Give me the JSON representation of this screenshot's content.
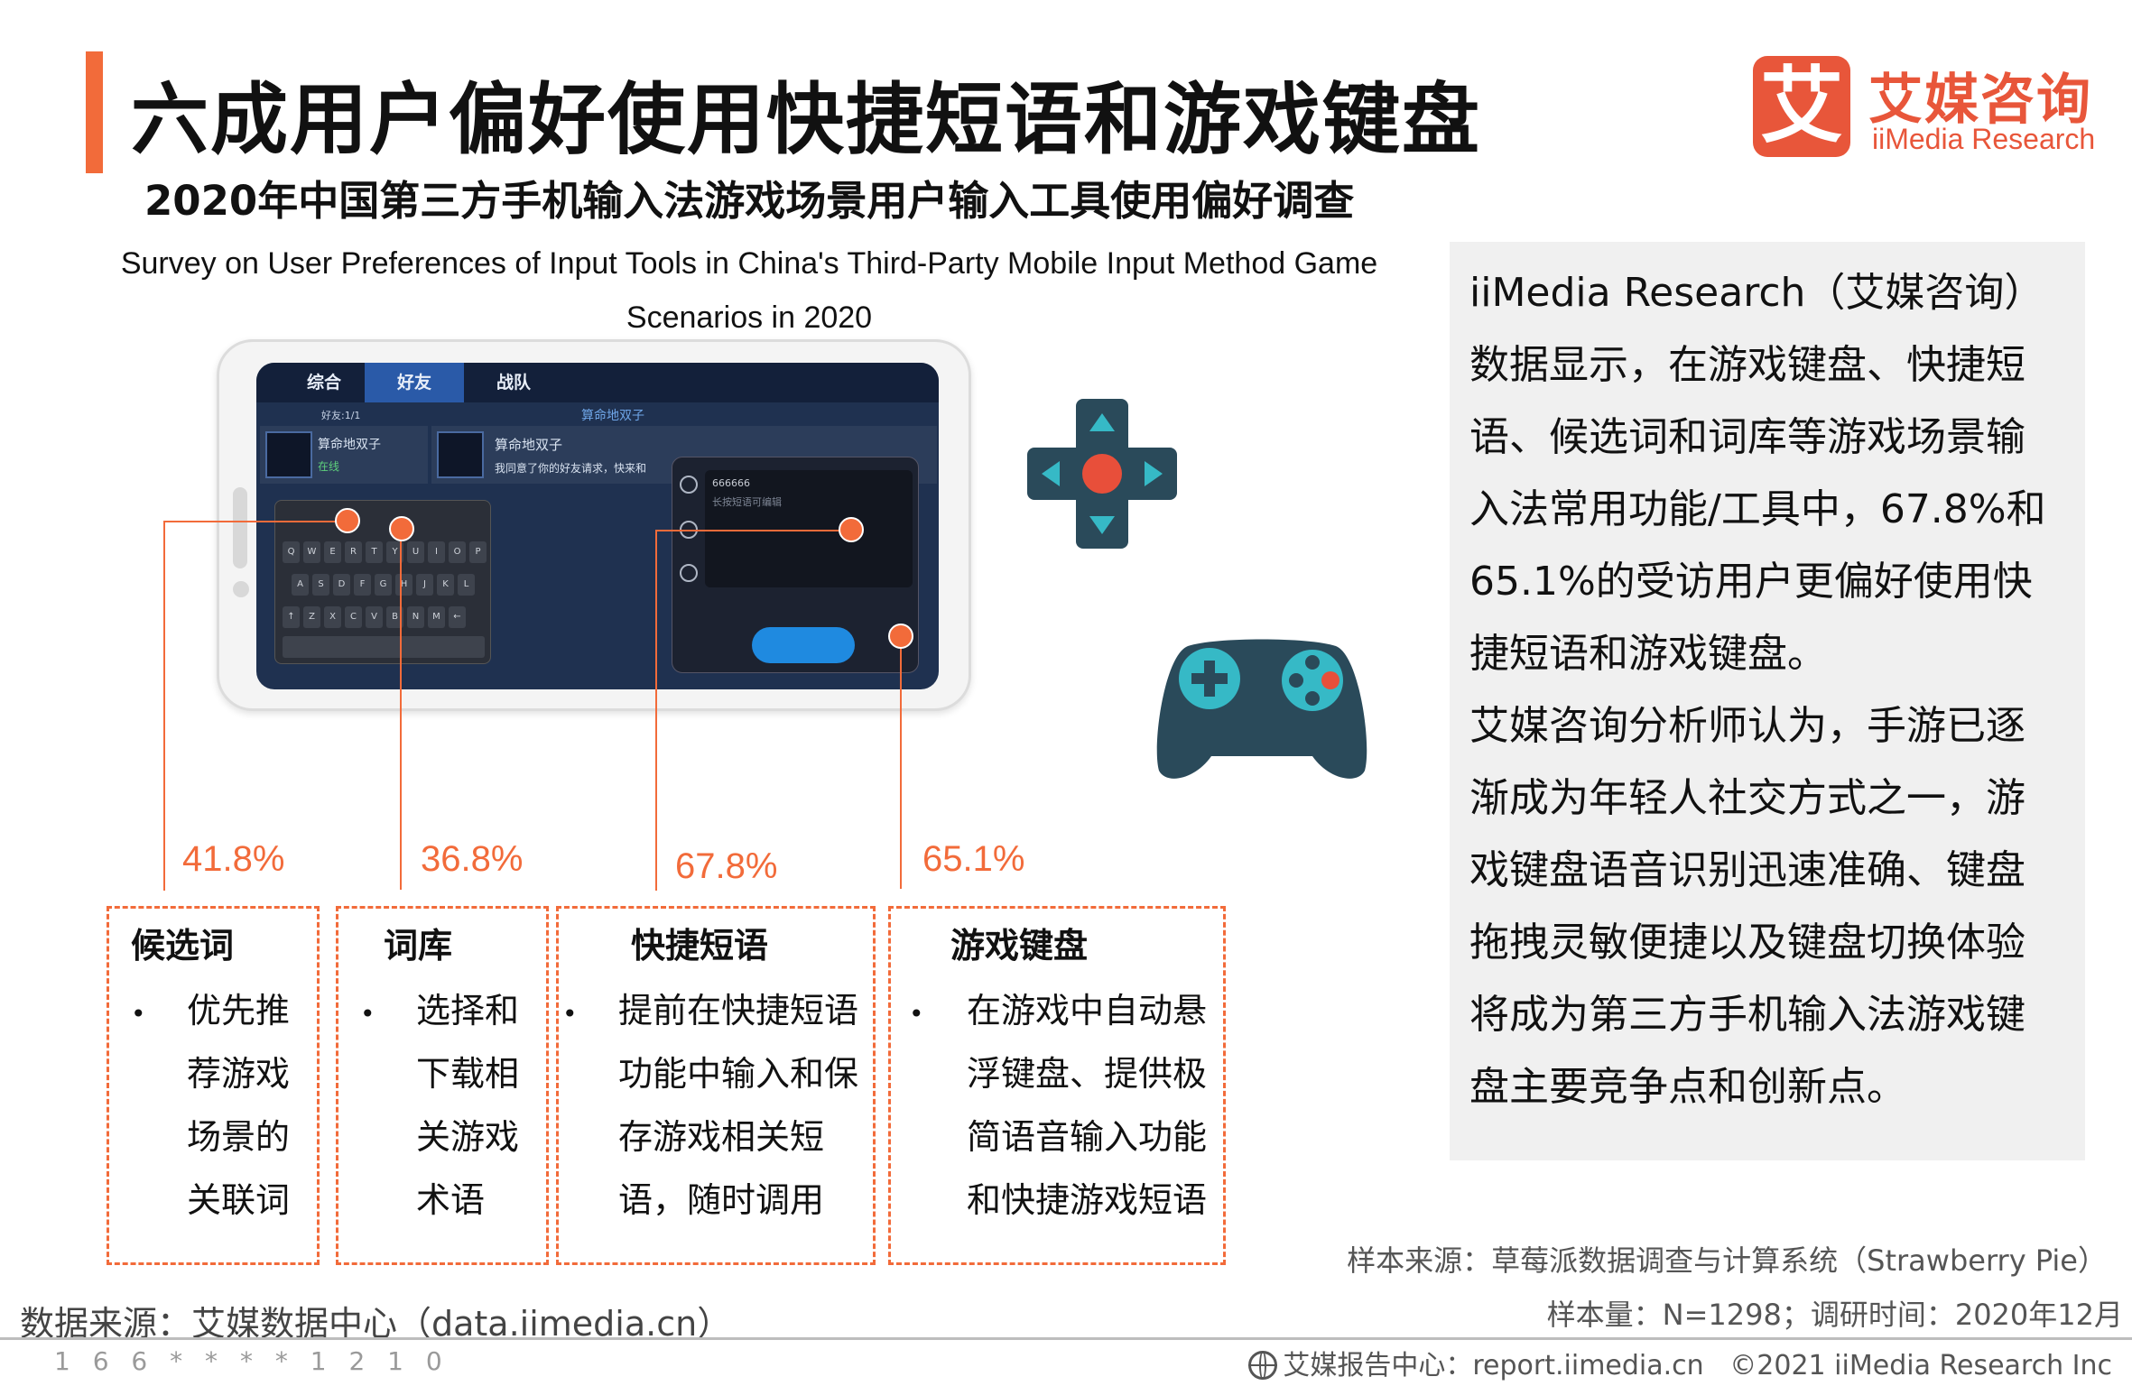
{
  "header": {
    "title": "六成用户偏好使用快捷短语和游戏键盘",
    "subtitle_cn": "2020年中国第三方手机输入法游戏场景用户输入工具使用偏好调查",
    "subtitle_en": "Survey on User Preferences of Input Tools in China's Third-Party Mobile Input Method Game Scenarios in 2020"
  },
  "logo": {
    "mark": "艾",
    "name_cn": "艾媒咨询",
    "name_en": "iiMedia Research",
    "color": "#e8563a"
  },
  "screenshot": {
    "tabs": [
      "综合",
      "好友",
      "战队"
    ],
    "active_tab": 1,
    "friend_name_1": "算命地双子",
    "friend_status_1": "在线",
    "friend_name_2": "算命地双子",
    "friend_msg": "我同意了你的好友请求，快来和",
    "friend_header": "好友:1/1",
    "phrase_input": "666666",
    "phrase_hint": "长按短语可编辑",
    "keys_row1": [
      "Q",
      "W",
      "E",
      "R",
      "T",
      "Y",
      "U",
      "I",
      "O",
      "P"
    ],
    "keys_row2": [
      "A",
      "S",
      "D",
      "F",
      "G",
      "H",
      "J",
      "K",
      "L"
    ],
    "keys_row3": [
      "↑",
      "Z",
      "X",
      "C",
      "V",
      "B",
      "N",
      "M",
      "←"
    ]
  },
  "icons": {
    "dpad": "dpad-icon",
    "gamepad": "gamepad-icon",
    "dpad_color": "#2a4a5a",
    "accent": "#e84f3a",
    "teal": "#36b9c6"
  },
  "features": [
    {
      "percent": "41.8%",
      "title": "候选词",
      "bullet": "•",
      "lines": [
        "优先推",
        "荐游戏",
        "场景的",
        "关联词"
      ]
    },
    {
      "percent": "36.8%",
      "title": "词库",
      "bullet": "•",
      "lines": [
        "选择和",
        "下载相",
        "关游戏",
        "术语"
      ]
    },
    {
      "percent": "67.8%",
      "title": "快捷短语",
      "bullet": "•",
      "lines": [
        "提前在快捷短语",
        "功能中输入和保",
        "存游戏相关短",
        "语，随时调用"
      ]
    },
    {
      "percent": "65.1%",
      "title": "游戏键盘",
      "bullet": "•",
      "lines": [
        "在游戏中自动悬",
        "浮键盘、提供极",
        "简语音输入功能",
        "和快捷游戏短语"
      ]
    }
  ],
  "analysis": {
    "lines": [
      "iiMedia Research（艾媒咨询）",
      "数据显示，在游戏键盘、快捷短",
      "语、候选词和词库等游戏场景输",
      "入法常用功能/工具中，67.8%和",
      "65.1%的受访用户更偏好使用快",
      "捷短语和游戏键盘。",
      "艾媒咨询分析师认为，手游已逐",
      "渐成为年轻人社交方式之一，游",
      "戏键盘语音识别迅速准确、键盘",
      "拖拽灵敏便捷以及键盘切换体验",
      "将成为第三方手机输入法游戏键",
      "盘主要竞争点和创新点。"
    ]
  },
  "footer": {
    "data_source": "数据来源：艾媒数据中心（data.iimedia.cn）",
    "sample_source": "样本来源：草莓派数据调查与计算系统（Strawberry Pie）",
    "sample_size": "样本量：N=1298；调研时间：2020年12月",
    "report_center": "艾媒报告中心：report.iimedia.cn",
    "copyright": "©2021  iiMedia Research  Inc",
    "watermark": "1 6 6 * * * * 1 2 1 0"
  }
}
